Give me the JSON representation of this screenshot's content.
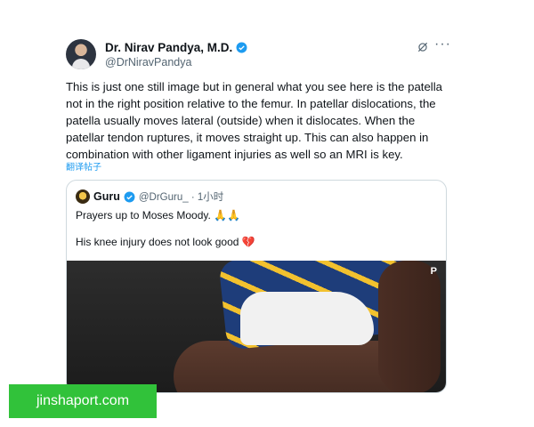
{
  "author": {
    "name": "Dr. Nirav Pandya, M.D.",
    "handle": "@DrNiravPandya"
  },
  "tweet_text": "This is just one still image but in general what you see here is the patella\nnot in the right position relative to the femur. In patellar dislocations, the\npatella usually moves lateral (outside) when it dislocates.  When the\npatellar tendon ruptures, it moves straight up.  This can also happen in\ncombination with other ligament injuries as well so an MRI is key.",
  "translate_label": "翻译帖子",
  "more_label": "···",
  "quote": {
    "name": "Guru",
    "handle_time": "@DrGuru_ · 1小时",
    "line1": "Prayers up to Moses Moody.",
    "line1_emoji": "🙏🙏",
    "line2": "His knee injury does not look good",
    "line2_emoji": "💔",
    "media_logo": "P"
  },
  "watermark": "jinshaport.com",
  "colors": {
    "verified": "#1d9bf0",
    "watermark_bg": "#31c23a"
  }
}
